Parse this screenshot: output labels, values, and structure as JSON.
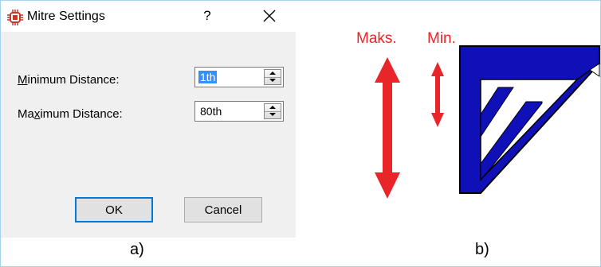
{
  "dialog": {
    "title": "Mitre Settings",
    "help_label": "?",
    "fields": [
      {
        "label_pre": "",
        "label_key": "M",
        "label_post": "inimum Distance:",
        "value": "1th",
        "selected": true
      },
      {
        "label_pre": "Ma",
        "label_key": "x",
        "label_post": "imum Distance:",
        "value": "80th",
        "selected": false
      }
    ],
    "ok_label": "OK",
    "cancel_label": "Cancel"
  },
  "figure": {
    "max_label": "Maks.",
    "min_label": "Min.",
    "colors": {
      "arrow": "#e8262a",
      "shape": "#1010b8",
      "outline": "#000000"
    }
  },
  "captions": {
    "a": "a)",
    "b": "b)"
  }
}
